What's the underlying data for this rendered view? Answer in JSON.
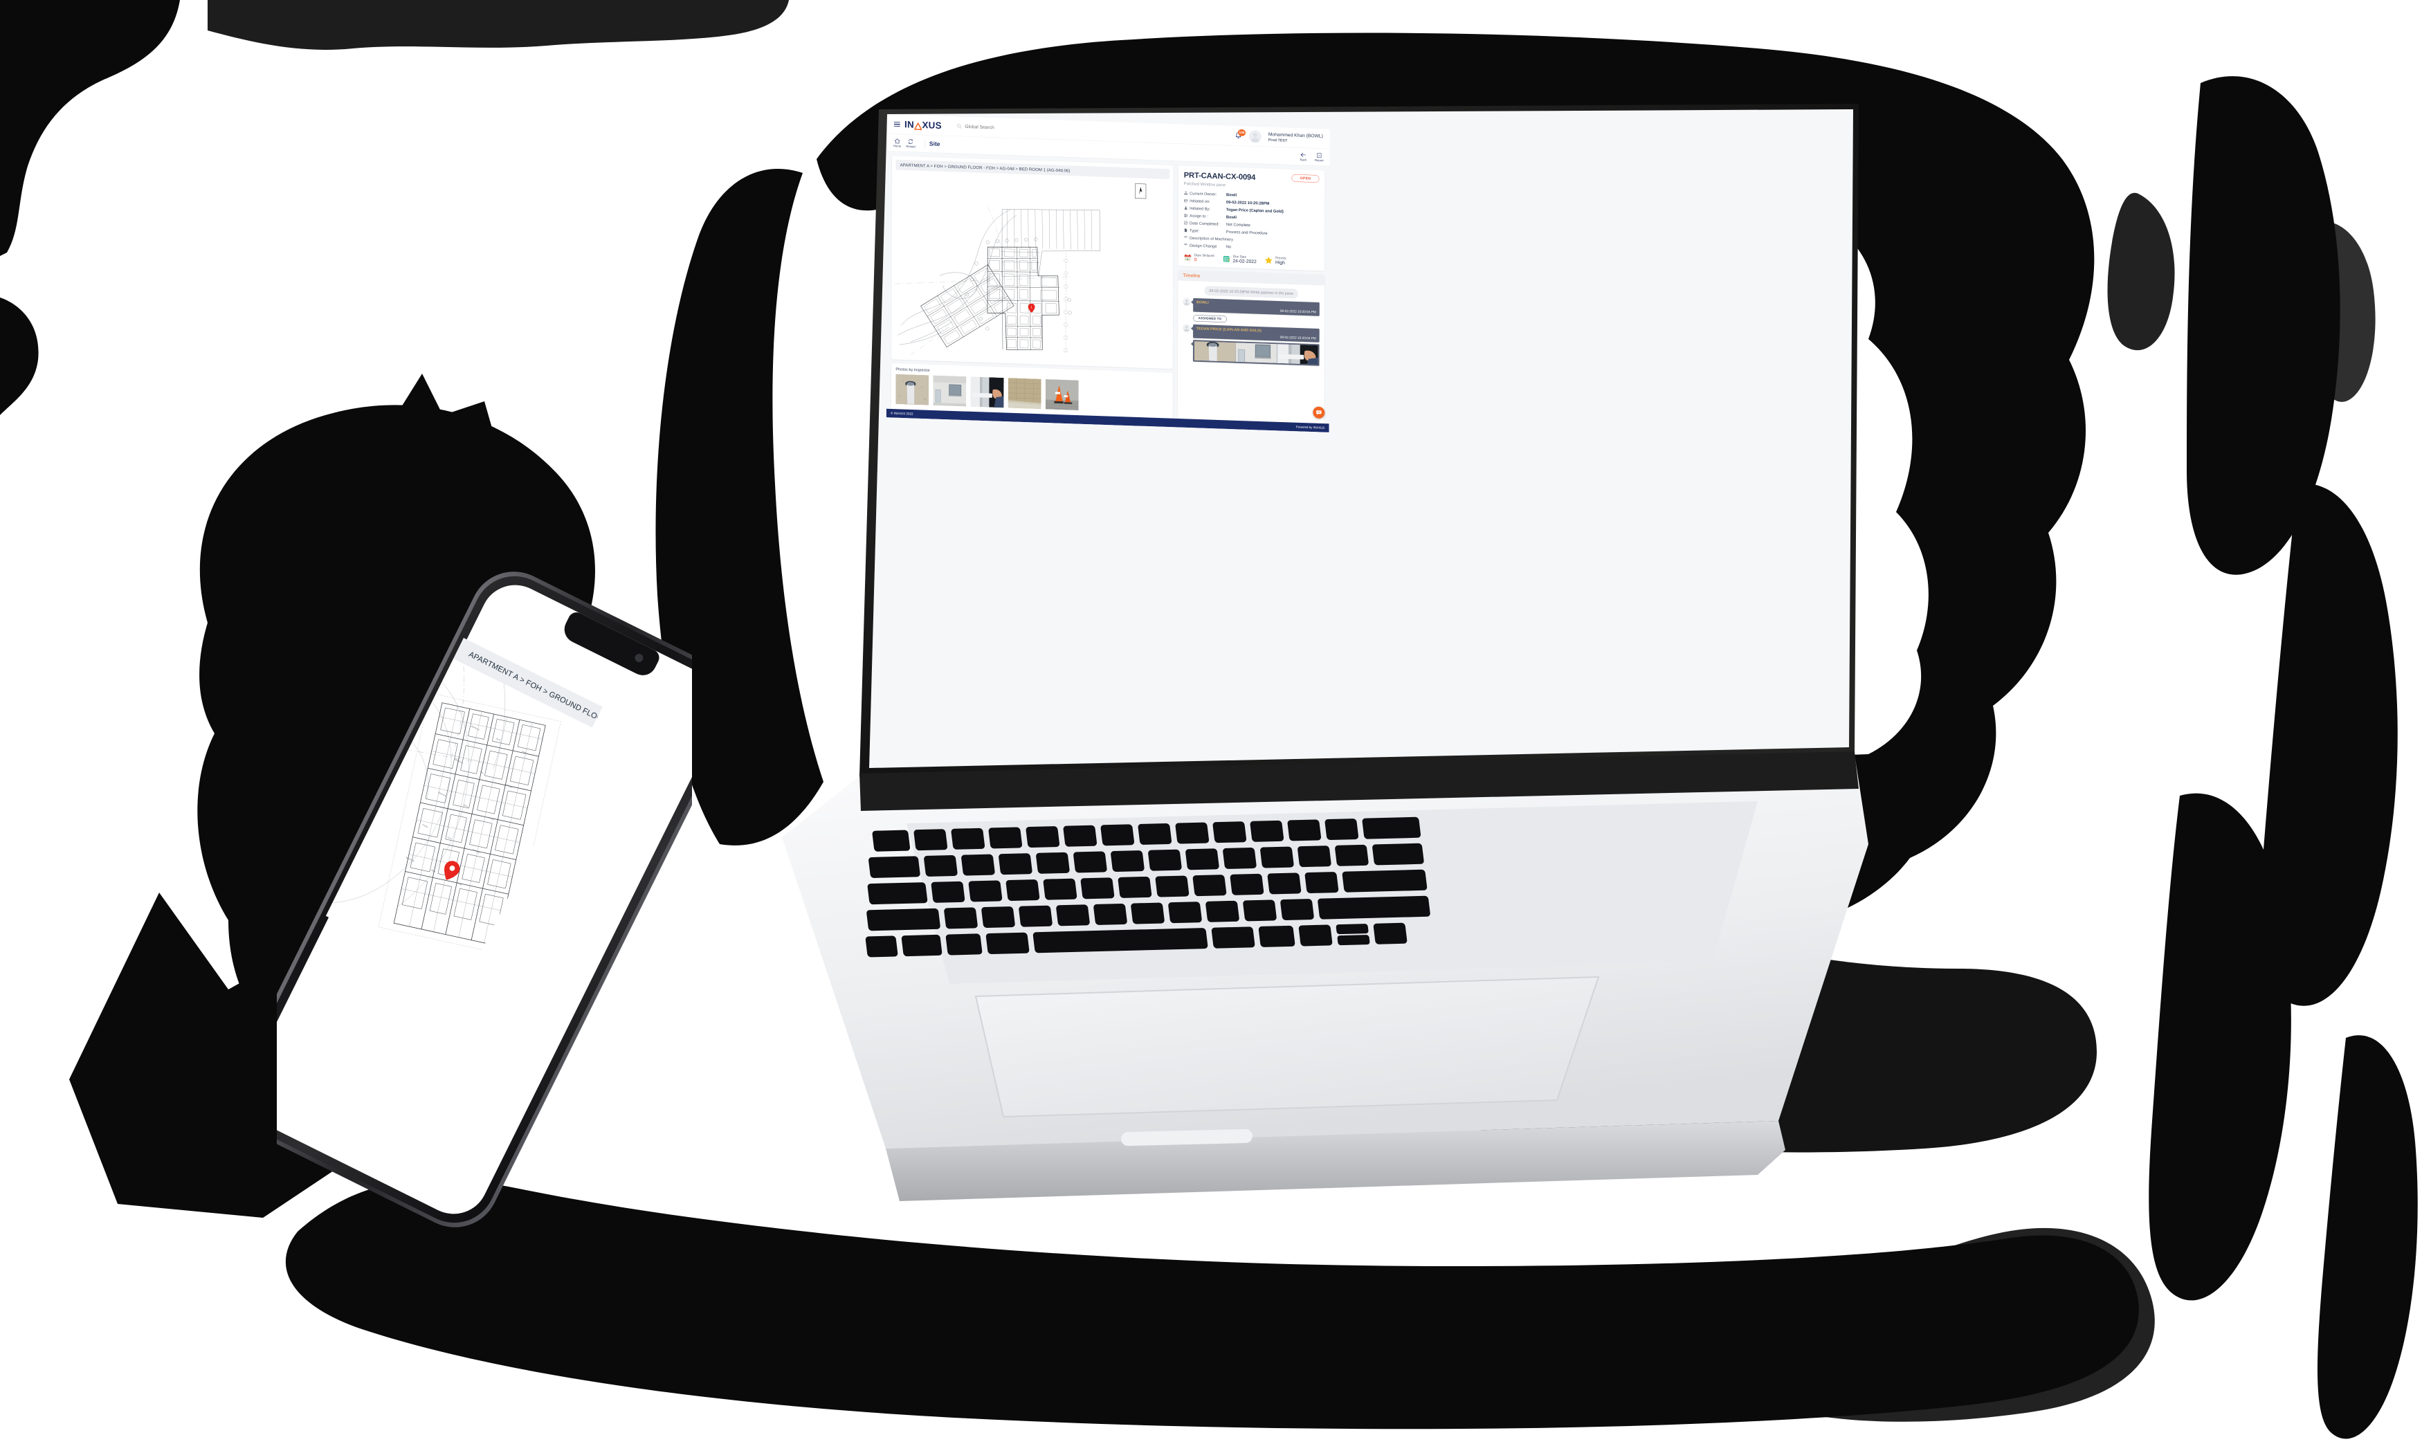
{
  "scene": {
    "description": "INAXUS construction-issue tracking web app shown on a laptop with a companion mobile app on a phone, over a black ink-brush backdrop"
  },
  "desktop": {
    "topbar": {
      "menu_icon": "hamburger-menu-icon",
      "logo_text_left": "IN",
      "logo_text_right": "XUS",
      "search": {
        "icon": "search-icon",
        "placeholder": "Global Search",
        "value": ""
      },
      "notifications": {
        "icon": "bell-icon",
        "count": "105"
      },
      "user": {
        "avatar": "user-avatar",
        "name": "Mohammed Khan (BOWL)",
        "role": "Prod TEST"
      }
    },
    "subbar": {
      "tools": [
        {
          "icon": "home-icon",
          "label": "Home"
        },
        {
          "icon": "reload-icon",
          "label": "Reload"
        }
      ],
      "active_tab": "Site",
      "right_tools": [
        {
          "icon": "arrow-left-icon",
          "label": "Back"
        },
        {
          "icon": "pdf-report-icon",
          "label": "Report"
        }
      ]
    },
    "plan": {
      "breadcrumb": "APARTMENT A > FOH > GROUND FLOOR - FOH > AG-04d > BED ROOM 1 (AG-04d.06)",
      "north_arrow": "north-arrow-icon",
      "marker_label": "1"
    },
    "photos": {
      "title": "Photos by Inspector",
      "items": [
        {
          "name": "photo-concrete-pipe"
        },
        {
          "name": "photo-exterior-window"
        },
        {
          "name": "photo-window-hand"
        },
        {
          "name": "photo-tiled-wall"
        },
        {
          "name": "photo-traffic-cones"
        }
      ]
    },
    "detail": {
      "ticket_id": "PRT-CAAN-CX-0094",
      "status": "OPEN",
      "subtitle": "Patched Window pane",
      "fields": [
        {
          "icon": "org-chart-icon",
          "label": "Current Owner:",
          "value": "Bowli",
          "bold": true
        },
        {
          "icon": "calendar-icon",
          "label": "Initiated on:",
          "value": "09-02-2022 10:20:28PM",
          "bold": true
        },
        {
          "icon": "user-icon",
          "label": "Initiated By:",
          "value": "Tegan Price (Caplan and Gold)",
          "bold": true
        },
        {
          "icon": "assign-icon",
          "label": "Assign to :",
          "value": "Bowli",
          "bold": true
        },
        {
          "icon": "checkbox-icon",
          "label": "Date Completed:",
          "value": "Not Complete",
          "bold": false
        },
        {
          "icon": "document-icon",
          "label": "Type:",
          "value": "Process and Procedure",
          "bold": false
        },
        {
          "icon": "machinery-icon",
          "label": "Description of Machinery",
          "value": "",
          "bold": false
        },
        {
          "icon": "machinery-icon",
          "label": "Design Change",
          "value": "No",
          "bold": false
        }
      ],
      "stats": [
        {
          "icon": "calendar-red-icon",
          "label": "Days Delayed",
          "value": "0",
          "accent": "red"
        },
        {
          "icon": "checklist-icon",
          "label": "Due Date",
          "value": "24-02-2022",
          "accent": "dark"
        },
        {
          "icon": "star-icon",
          "label": "Priority",
          "value": "High",
          "accent": "dark"
        }
      ]
    },
    "timeline": {
      "title": "Timeline",
      "system_message": "09-02-2022 10:20:28PM White patches in the pane",
      "entries": [
        {
          "avatar": "user-avatar",
          "name": "BOWLI",
          "time": "09-02-2022 10:20:04 PM",
          "photos": []
        },
        {
          "avatar": "user-avatar",
          "name": "TEGAN PRICE (CAPLAN AND GOLD)",
          "time": "09-02-2022 10:20:04 PM",
          "photos": [
            "photo-concrete-pipe",
            "photo-exterior-window",
            "photo-window-hand"
          ]
        }
      ],
      "assigned_pill": "ASSIGNED TO"
    },
    "fab": {
      "icon": "chat-bubble-icon"
    },
    "footer": {
      "copyright": "© INAXUS 2022",
      "powered_by": "Powered by INAXUS"
    }
  },
  "mobile": {
    "back_icon": "arrow-left-icon",
    "breadcrumb": "APARTMENT A > FOH > GROUND FLOOR",
    "marker": "map-pin-icon"
  },
  "colors": {
    "brand_navy": "#1c2a63",
    "brand_orange": "#f26522",
    "status_open": "#f4543c",
    "bubble_slate": "#5c6378",
    "bubble_name_gold": "#e2b866",
    "footer_navy": "#1b2c6b",
    "pin_red": "#e8251f"
  }
}
